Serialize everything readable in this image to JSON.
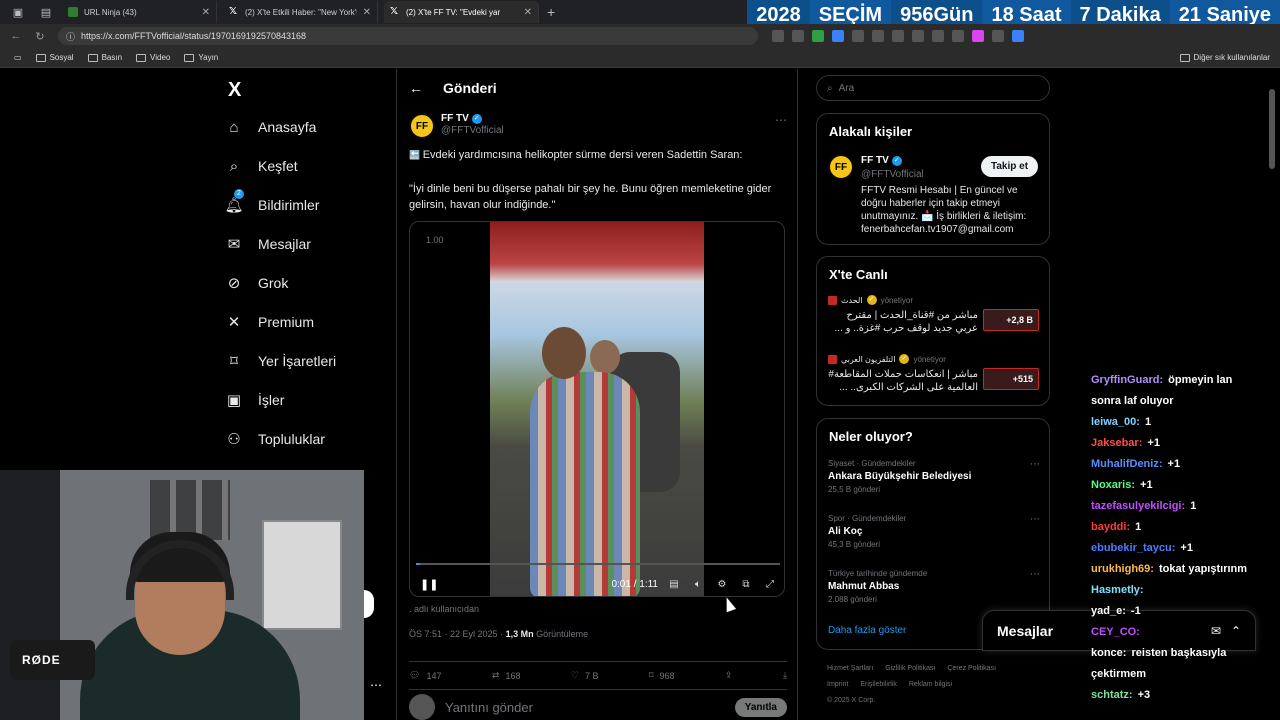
{
  "browser": {
    "tabs": [
      {
        "title": "URL Ninja (43)",
        "icon": "green-square-icon"
      },
      {
        "title": "(2) X'te Etkili Haber: \"New York'ta",
        "icon": "x-logo-icon"
      },
      {
        "title": "(2) X'te FF TV: \"Evdeki yar",
        "icon": "x-logo-icon"
      }
    ],
    "url": "https://x.com/FFTVofficial/status/1970169192570843168",
    "bookmarks": [
      "Sosyal",
      "Basın",
      "Video",
      "Yayın"
    ],
    "bookmarks_right": "Diğer sık kullanılanlar"
  },
  "countdown": {
    "year": "2028",
    "label": "SEÇİM",
    "days": "956",
    "days_unit": "Gün",
    "hours": "18",
    "hours_unit": "Saat",
    "minutes": "7",
    "minutes_unit": "Dakika",
    "seconds": "21",
    "seconds_unit": "Saniye"
  },
  "nav": {
    "logo": "X",
    "items": [
      {
        "label": "Anasayfa",
        "icon": "home-icon"
      },
      {
        "label": "Keşfet",
        "icon": "search-icon"
      },
      {
        "label": "Bildirimler",
        "icon": "bell-icon",
        "badge": "2"
      },
      {
        "label": "Mesajlar",
        "icon": "mail-icon"
      },
      {
        "label": "Grok",
        "icon": "grok-icon"
      },
      {
        "label": "Premium",
        "icon": "x-icon"
      },
      {
        "label": "Yer İşaretleri",
        "icon": "bookmark-icon"
      },
      {
        "label": "İşler",
        "icon": "briefcase-icon"
      },
      {
        "label": "Topluluklar",
        "icon": "people-icon"
      }
    ]
  },
  "post": {
    "header_title": "Gönderi",
    "author_name": "FF TV",
    "author_handle": "@FFTVofficial",
    "avatar_text": "FF",
    "text_line1": "Evdeki yardımcısına helikopter sürme dersi veren Sadettin Saran:",
    "text_quote": "\"İyi dinle beni bu düşerse pahalı bir şey he. Bunu öğren memleketine gider gelirsin, havan olur indiğinde.\"",
    "video_speed": "1.00",
    "video_time": "0:01 / 1:11",
    "video_progress": 0.01,
    "alt_text": ". adlı kullanıcıdan",
    "time": "ÖS 7:51 · 22 Eyl 2025 · ",
    "views": "1,3 Mn",
    "views_label": " Görüntüleme",
    "replies": "147",
    "reposts": "168",
    "likes": "7 B",
    "bookmarks": "968",
    "reply_placeholder": "Yanıtını gönder",
    "reply_button": "Yanıtla"
  },
  "right": {
    "search_placeholder": "Ara",
    "related_title": "Alakalı kişiler",
    "related": {
      "name": "FF TV",
      "handle": "@FFTVofficial",
      "bio": "FFTV Resmi Hesabı | En güncel ve doğru haberler için takip etmeyi unutmayınız. 📩 İş birlikleri & iletişim: fenerbahcefan.tv1907@gmail.com",
      "follow": "Takip et"
    },
    "live_title": "X'te Canlı",
    "live": [
      {
        "source": "الحدث",
        "status": "yönetiyor",
        "title": "مباشر من #قناة_الحدث | مقترح عربي جديد لوقف حرب #غزة.. و ...",
        "count": "+2,8 B"
      },
      {
        "source": "التلفزيون العربي",
        "status": "yönetiyor",
        "title": "مباشر | انعكاسات حملات المقاطعة# العالمية على الشركات الكبرى.. ...",
        "count": "+515"
      }
    ],
    "trends_title": "Neler oluyor?",
    "trends": [
      {
        "category": "Siyaset · Gündemdekiler",
        "title": "Ankara Büyükşehir Belediyesi",
        "count": "25,5 B gönderi"
      },
      {
        "category": "Spor · Gündemdekiler",
        "title": "Ali Koç",
        "count": "45,3 B gönderi"
      },
      {
        "category": "Türkiye tarihinde gündemde",
        "title": "Mahmut Abbas",
        "count": "2.088 gönderi"
      }
    ],
    "show_more": "Daha fazla göster",
    "footer": [
      "Hizmet Şartları",
      "Gizlilik Politikası",
      "Çerez Politikası",
      "Imprint",
      "Erişilebilirlik",
      "Reklam bilgisi",
      "© 2025 X Corp."
    ]
  },
  "messages_bar": {
    "title": "Mesajlar"
  },
  "chat": [
    {
      "user": "GryffinGuard:",
      "msg": " öpmeyin lan",
      "color": "#b48cff"
    },
    {
      "user": "",
      "msg": "sonra laf oluyor",
      "color": "#ffffff"
    },
    {
      "user": "leiwa_00:",
      "msg": " 1",
      "color": "#7fd3ff"
    },
    {
      "user": "Jaksebar:",
      "msg": " +1",
      "color": "#ff4d4d"
    },
    {
      "user": "MuhalifDeniz:",
      "msg": " +1",
      "color": "#5b8cff"
    },
    {
      "user": "Noxaris:",
      "msg": " +1",
      "color": "#4dff88"
    },
    {
      "user": "tazefasulyekilcigi:",
      "msg": " 1",
      "color": "#c14dff"
    },
    {
      "user": "bayddi:",
      "msg": " 1",
      "color": "#ff3b3b"
    },
    {
      "user": "ebubekir_taycu:",
      "msg": " +1",
      "color": "#4d7dff"
    },
    {
      "user": "urukhigh69:",
      "msg": " tokat yapıştırınm",
      "color": "#ffb84d"
    },
    {
      "user": "Hasmetly:",
      "msg": " ",
      "color": "#7fe0ff"
    },
    {
      "user": "yad_e:",
      "msg": " -1",
      "color": "#ffffff"
    },
    {
      "user": "CEY_CO:",
      "msg": " ",
      "color": "#c14dff"
    },
    {
      "user": "konce:",
      "msg": " reisten başkasıyla",
      "color": "#ffffff"
    },
    {
      "user": "",
      "msg": "çektirmem",
      "color": "#ffffff"
    },
    {
      "user": "schtatz:",
      "msg": " +3",
      "color": "#7fe0a0"
    }
  ],
  "webcam": {
    "mic_brand": "RØDE"
  },
  "colors": {
    "accent": "#1d9bf0",
    "countdown_bg": "#0d4f8b"
  }
}
